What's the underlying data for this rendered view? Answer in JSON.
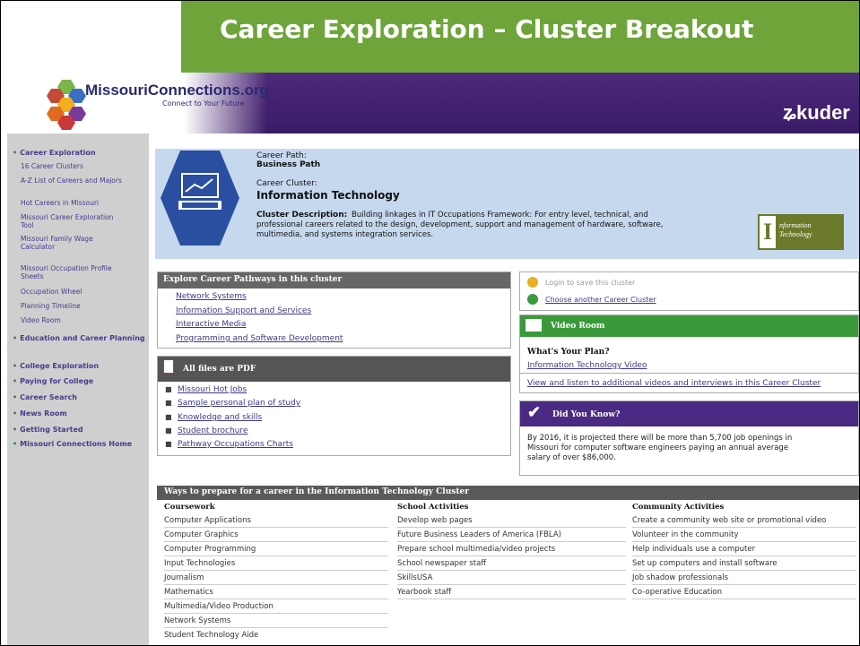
{
  "slide_title": "Career Exploration – Cluster Breakout",
  "site": {
    "logo_text": "MissouriConnections.org",
    "logo_sub": "Connect to Your Future",
    "partner": "ʑkuder"
  },
  "nav": {
    "items": [
      {
        "label": "Career Exploration",
        "sub": [
          "16 Career Clusters",
          "A-Z List of Careers and Majors",
          "Hot Careers in Missouri",
          "Missouri Career Exploration Tool",
          "Missouri Family Wage Calculator",
          "Missouri Occupation Profile Sheets",
          "Occupation Wheel",
          "Planning Timeline",
          "Video Room"
        ]
      },
      {
        "label": "Education and Career Planning"
      },
      {
        "label": "College Exploration"
      },
      {
        "label": "Paying for College"
      },
      {
        "label": "Career Search"
      },
      {
        "label": "News Room"
      },
      {
        "label": "Getting Started"
      },
      {
        "label": "Missouri Connections Home"
      }
    ]
  },
  "cluster": {
    "path_label": "Career Path:",
    "path_value": "Business Path",
    "cluster_label": "Career Cluster:",
    "cluster_value": "Information Technology",
    "desc_label": "Cluster Description:",
    "desc_lines": [
      "Building linkages in IT Occupations Framework: For entry level, technical, and",
      "professional careers related to the design, development, support and management of hardware, software,",
      "multimedia, and systems integration services."
    ],
    "badge_letter": "I",
    "badge_text": "nformation Technology"
  },
  "explore": {
    "title": "Explore Career Pathways in this cluster",
    "links": [
      "Network Systems",
      "Information Support and Services",
      "Interactive Media",
      "Programming and Software Development"
    ]
  },
  "pdf": {
    "title": "All files are PDF",
    "links": [
      "Missouri Hot Jobs",
      "Sample personal plan of study",
      "Knowledge and skills",
      "Student brochure",
      "Pathway Occupations Charts"
    ]
  },
  "login": {
    "save_text": "Login to save this cluster",
    "choose_text": "Choose another Career Cluster"
  },
  "video": {
    "title": "Video Room",
    "subtitle": "What's Your Plan?",
    "link1": "Information Technology Video",
    "link2": "View and listen to additional videos and interviews in this Career Cluster"
  },
  "dyk": {
    "title": "Did You Know?",
    "lines": [
      "By 2016, it is projected there will be more than 5,700 job openings in",
      "Missouri for computer software engineers paying an annual average",
      "salary of over $86,000."
    ]
  },
  "ways": {
    "title": "Ways to prepare for a career in the Information Technology Cluster",
    "columns": [
      {
        "title": "Coursework",
        "items": [
          "Computer Applications",
          "Computer Graphics",
          "Computer Programming",
          "Input Technologies",
          "Journalism",
          "Mathematics",
          "Multimedia/Video Production",
          "Network Systems",
          "Student Technology Aide"
        ]
      },
      {
        "title": "School Activities",
        "items": [
          "Develop web pages",
          "Future Business Leaders of America (FBLA)",
          "Prepare school multimedia/video projects",
          "School newspaper staff",
          "SkillsUSA",
          "Yearbook staff"
        ]
      },
      {
        "title": "Community Activities",
        "items": [
          "Create a community web site or promotional video",
          "Volunteer in the community",
          "Help individuals use a computer",
          "Set up computers and install software",
          "Job shadow professionals",
          "Co-operative Education"
        ]
      }
    ]
  },
  "colors": {
    "title_green": "#6ea43a",
    "header_purple": "#4e2a7a",
    "nav_gray": "#cfcfcf",
    "cluster_blue": "#c6d8ee"
  }
}
